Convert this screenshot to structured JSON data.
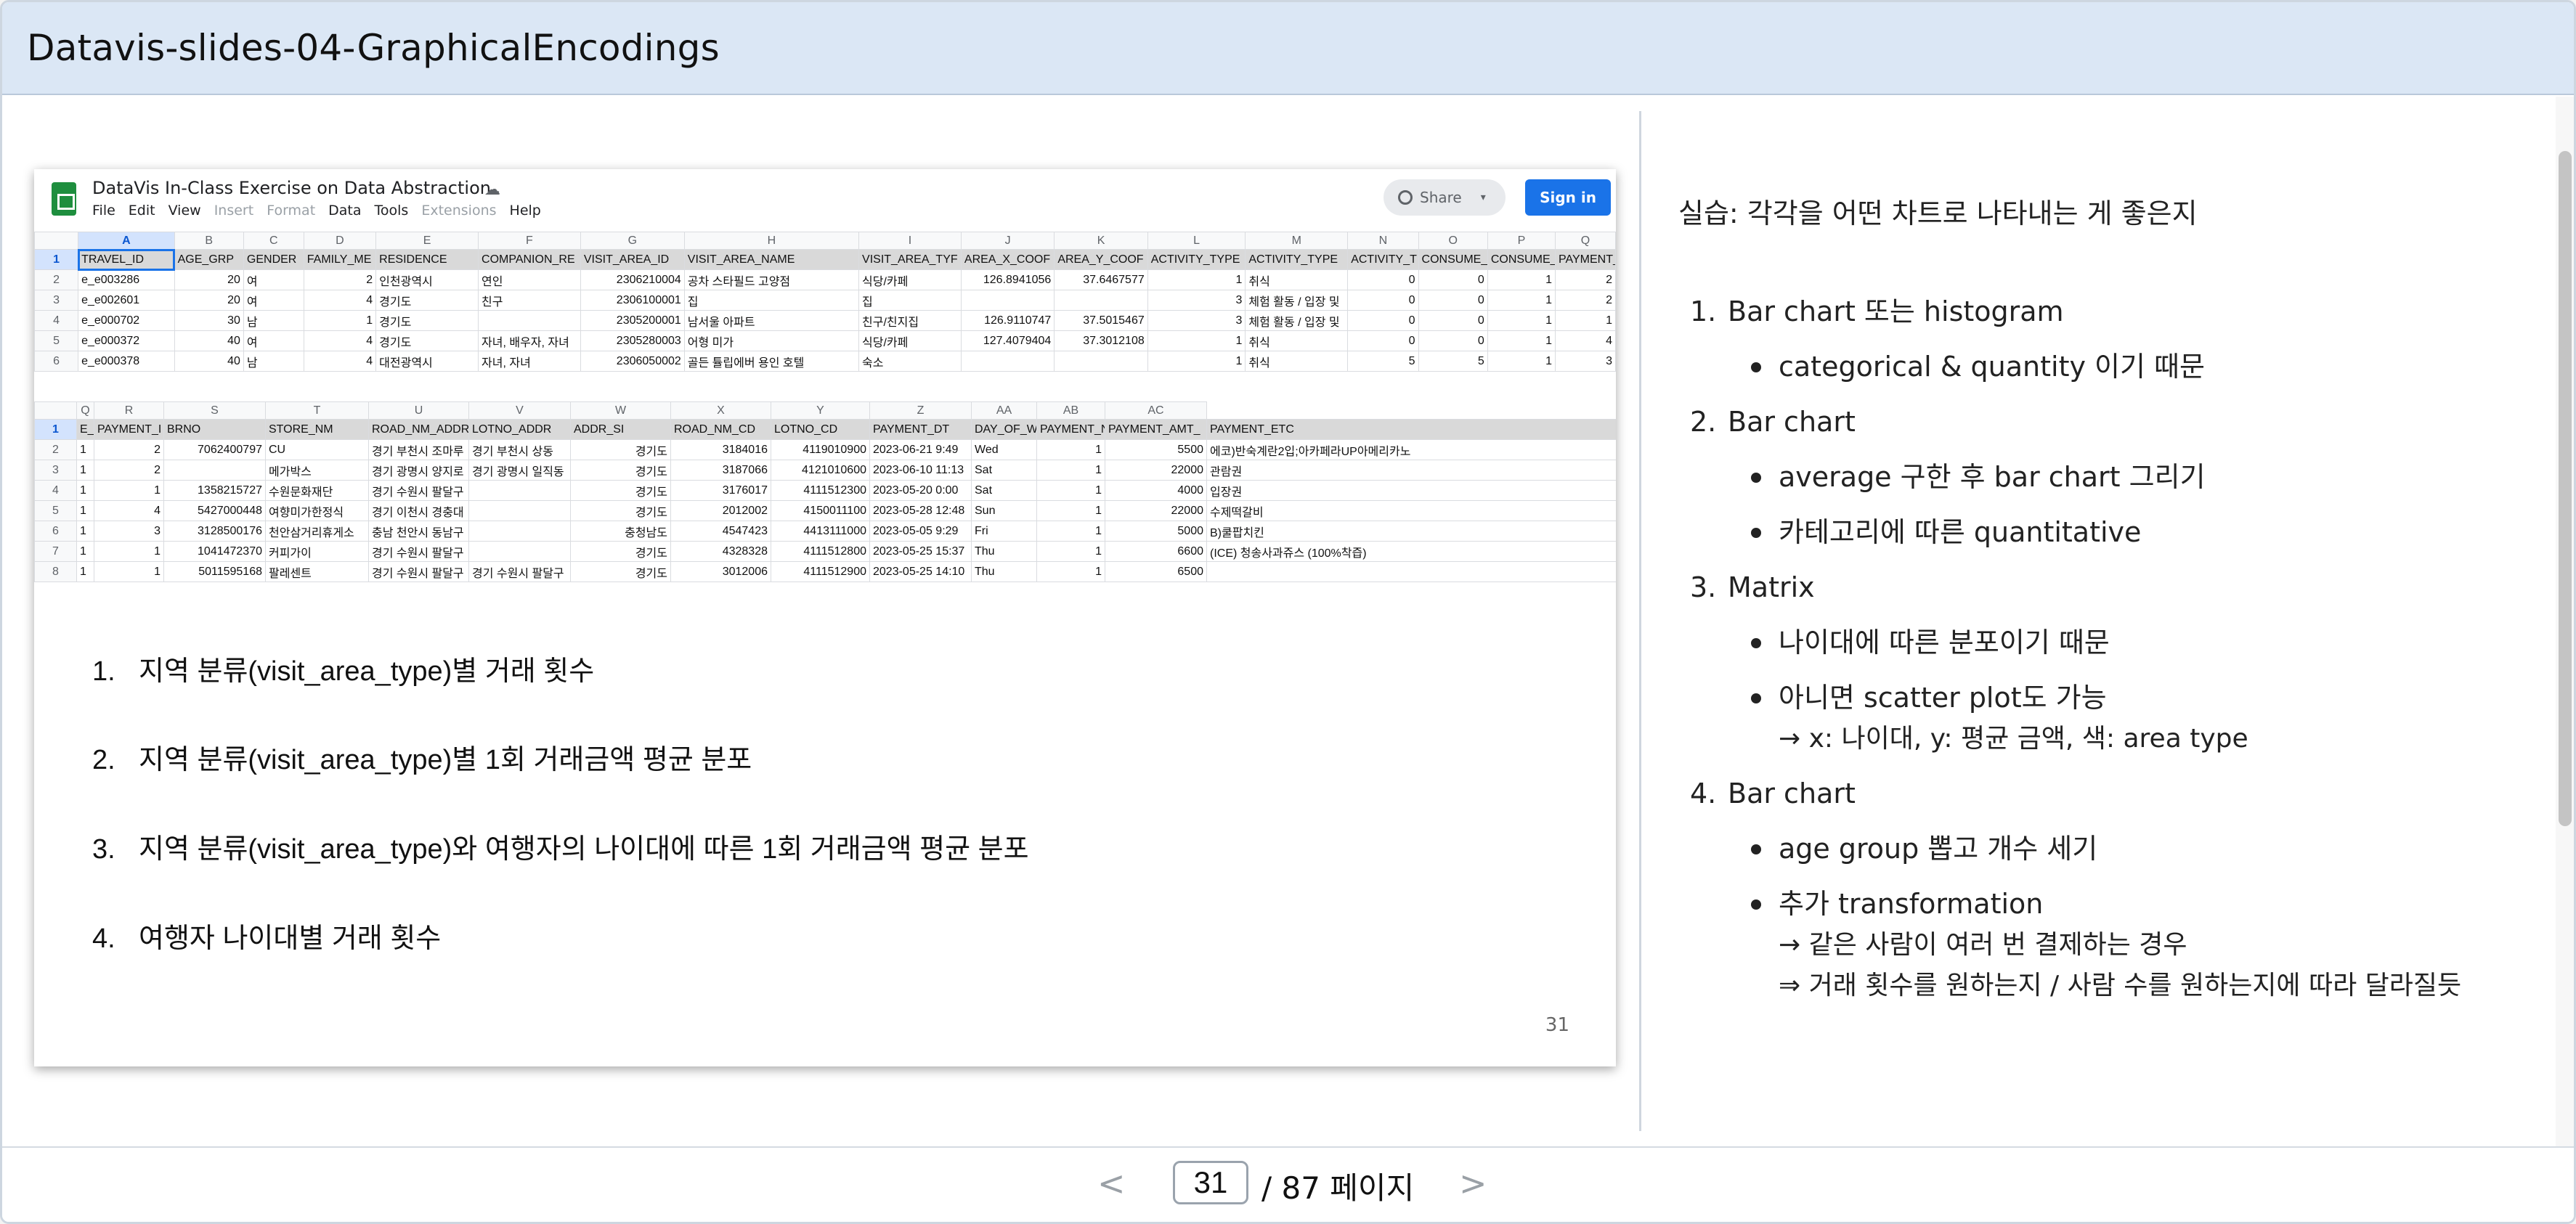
{
  "title": "Datavis-slides-04-GraphicalEncodings",
  "sheet": {
    "doc_title": "DataVis In-Class Exercise on Data Abstraction",
    "menu": [
      "File",
      "Edit",
      "View",
      "Insert",
      "Format",
      "Data",
      "Tools",
      "Extensions",
      "Help"
    ],
    "share_label": "Share",
    "signin_label": "Sign in",
    "table1": {
      "col_letters": [
        "A",
        "B",
        "C",
        "D",
        "E",
        "F",
        "G",
        "H",
        "I",
        "J",
        "K",
        "L",
        "M",
        "N",
        "O",
        "P",
        "Q"
      ],
      "header": [
        "TRAVEL_ID",
        "AGE_GRP",
        "GENDER",
        "FAMILY_ME",
        "RESIDENCE",
        "COMPANION_RE",
        "VISIT_AREA_ID",
        "VISIT_AREA_NAME",
        "VISIT_AREA_TYF",
        "AREA_X_COOF",
        "AREA_Y_COOF",
        "ACTIVITY_TYPE",
        "ACTIVITY_TYPE",
        "ACTIVITY_T",
        "CONSUME_",
        "CONSUME_",
        "PAYMENT_I"
      ],
      "rows": [
        [
          "2",
          "e_e003286",
          "20",
          "여",
          "2",
          "인천광역시",
          "연인",
          "2306210004",
          "공차 스타필드 고양점",
          "식당/카페",
          "126.8941056",
          "37.6467577",
          "1",
          "취식",
          "0",
          "0",
          "1",
          "2"
        ],
        [
          "3",
          "e_e002601",
          "20",
          "여",
          "4",
          "경기도",
          "친구",
          "2306100001",
          "집",
          "집",
          "",
          "",
          "3",
          "체험 활동 / 입장 및",
          "0",
          "0",
          "1",
          "2"
        ],
        [
          "4",
          "e_e000702",
          "30",
          "남",
          "1",
          "경기도",
          "",
          "2305200001",
          "남서울 아파트",
          "친구/친지집",
          "126.9110747",
          "37.5015467",
          "3",
          "체험 활동 / 입장 및",
          "0",
          "0",
          "1",
          "1"
        ],
        [
          "5",
          "e_e000372",
          "40",
          "여",
          "4",
          "경기도",
          "자녀, 배우자, 자녀",
          "2305280003",
          "어형 미가",
          "식당/카페",
          "127.4079404",
          "37.3012108",
          "1",
          "취식",
          "0",
          "0",
          "1",
          "4"
        ],
        [
          "6",
          "e_e000378",
          "40",
          "남",
          "4",
          "대전광역시",
          "자녀, 자녀",
          "2306050002",
          "골든 튤립에버 용인 호텔",
          "숙소",
          "",
          "",
          "1",
          "취식",
          "5",
          "5",
          "1",
          "3"
        ]
      ]
    },
    "table2": {
      "col_letters": [
        "Q",
        "R",
        "S",
        "T",
        "U",
        "V",
        "W",
        "X",
        "Y",
        "Z",
        "AA",
        "AB",
        "AC"
      ],
      "header": [
        "E_",
        "PAYMENT_I",
        "BRNO",
        "STORE_NM",
        "ROAD_NM_ADDR",
        "LOTNO_ADDR",
        "ADDR_SI",
        "ROAD_NM_CD",
        "LOTNO_CD",
        "PAYMENT_DT",
        "DAY_OF_W",
        "PAYMENT_N",
        "PAYMENT_AMT_",
        "PAYMENT_ETC"
      ],
      "rows": [
        [
          "2",
          "1",
          "2",
          "7062400797",
          "CU",
          "경기 부천시 조마루",
          "경기 부천시 상동",
          "경기도",
          "3184016",
          "4119010900",
          "2023-06-21 9:49",
          "Wed",
          "1",
          "5500",
          "에코)반숙계란2입;아카페라UP아메리카노"
        ],
        [
          "3",
          "1",
          "2",
          "",
          "메가박스",
          "경기 광명시 양지로",
          "경기 광명시 일직동",
          "경기도",
          "3187066",
          "4121010600",
          "2023-06-10 11:13",
          "Sat",
          "1",
          "22000",
          "관람권"
        ],
        [
          "4",
          "1",
          "1",
          "1358215727",
          "수원문화재단",
          "경기 수원시 팔달구",
          "",
          "경기도",
          "3176017",
          "4111512300",
          "2023-05-20 0:00",
          "Sat",
          "1",
          "4000",
          "입장권"
        ],
        [
          "5",
          "1",
          "4",
          "5427000448",
          "여향미가한정식",
          "경기 이천시 경충대",
          "",
          "경기도",
          "2012002",
          "4150011100",
          "2023-05-28 12:48",
          "Sun",
          "1",
          "22000",
          "수제떡갈비"
        ],
        [
          "6",
          "1",
          "3",
          "3128500176",
          "천안삼거리휴게소",
          "충남 천안시 동남구",
          "",
          "충청남도",
          "4547423",
          "4413111000",
          "2023-05-05 9:29",
          "Fri",
          "1",
          "5000",
          "B)쿨팝치킨"
        ],
        [
          "7",
          "1",
          "1",
          "1041472370",
          "커피가이",
          "경기 수원시 팔달구",
          "",
          "경기도",
          "4328328",
          "4111512800",
          "2023-05-25 15:37",
          "Thu",
          "1",
          "6600",
          "(ICE) 청송사과쥬스 (100%착즙)"
        ],
        [
          "8",
          "1",
          "1",
          "5011595168",
          "팔레센트",
          "경기 수원시 팔달구",
          "경기 수원시 팔달구",
          "경기도",
          "3012006",
          "4111512900",
          "2023-05-25 14:10",
          "Thu",
          "1",
          "6500",
          ""
        ]
      ]
    }
  },
  "slide": {
    "items": [
      {
        "num": "1.",
        "text": "지역 분류(visit_area_type)별 거래 횟수"
      },
      {
        "num": "2.",
        "text": "지역 분류(visit_area_type)별 1회 거래금액 평균 분포"
      },
      {
        "num": "3.",
        "text": "지역 분류(visit_area_type)와 여행자의 나이대에 따른 1회 거래금액 평균 분포"
      },
      {
        "num": "4.",
        "text": "여행자 나이대별 거래 횟수"
      }
    ],
    "page_number": "31"
  },
  "notes": {
    "heading": "실습: 각각을 어떤 차트로 나타내는 게 좋은지",
    "item1": {
      "num": "1.",
      "label": "Bar chart 또는 histogram",
      "b1": "categorical & quantity 이기 때문"
    },
    "item2": {
      "num": "2.",
      "label": "Bar chart",
      "b1": "average 구한 후 bar chart 그리기",
      "b2": "카테고리에 따른 quantitative"
    },
    "item3": {
      "num": "3.",
      "label": "Matrix",
      "b1": "나이대에 따른 분포이기 때문",
      "b2": "아니면 scatter plot도 가능",
      "b2_cont": "→ x: 나이대, y: 평균 금액, 색: area type"
    },
    "item4": {
      "num": "4.",
      "label": "Bar chart",
      "b1": "age group 뽑고 개수 세기",
      "b2": "추가 transformation",
      "b2_cont1": "→ 같은 사람이 여러 번 결제하는 경우",
      "b2_cont2": "⇒ 거래 횟수를 원하는지 / 사람 수를 원하는지에 따라 달라질듯"
    }
  },
  "pager": {
    "prev": "<",
    "next": ">",
    "current_page": "31",
    "total_label": "/ 87 페이지"
  }
}
